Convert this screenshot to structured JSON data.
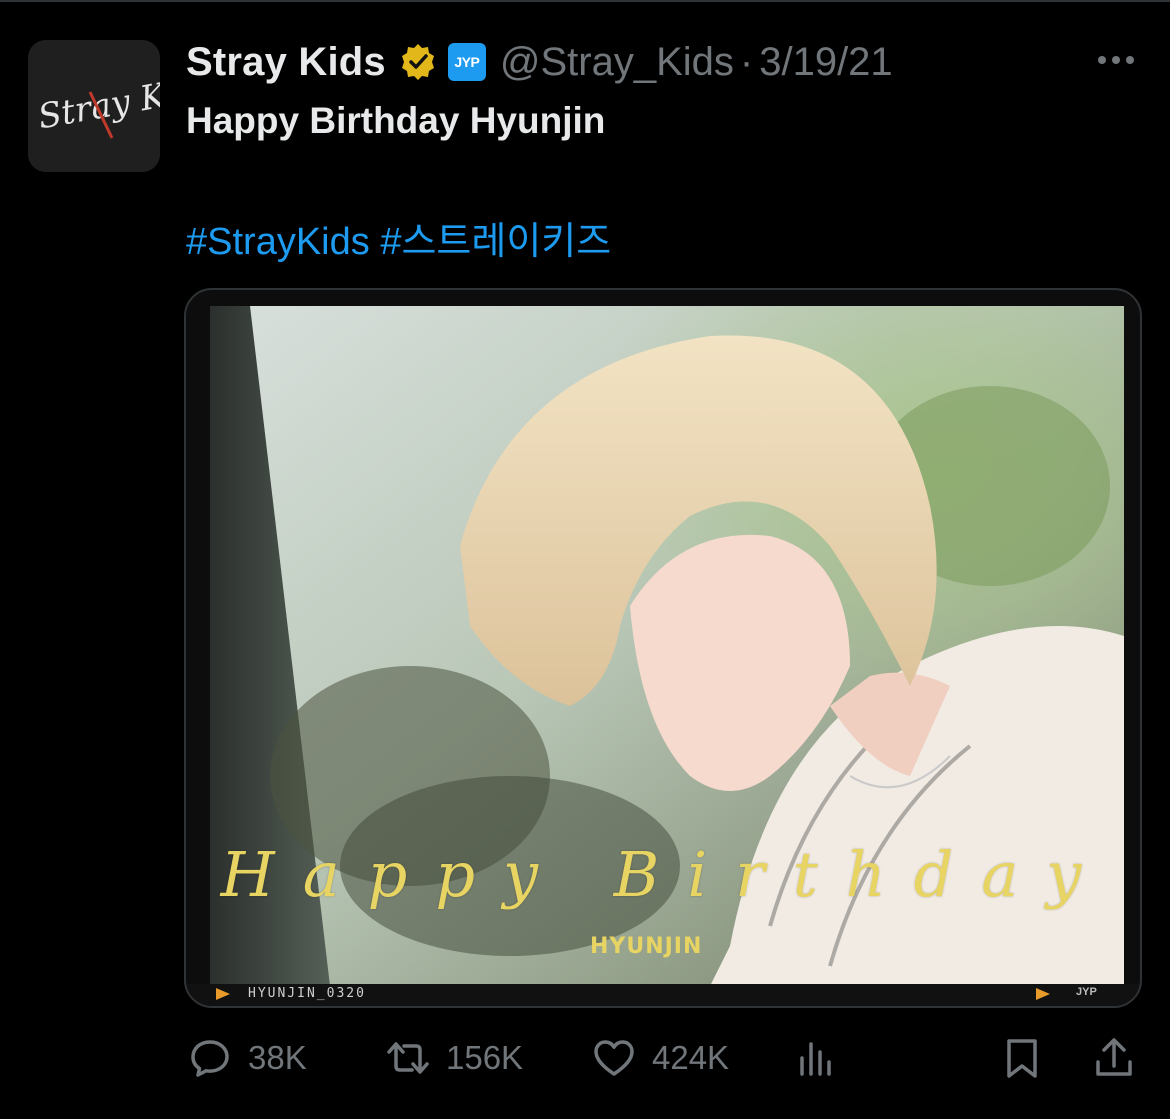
{
  "author": {
    "display_name": "Stray Kids",
    "handle": "@Stray_Kids",
    "separator": "·",
    "date": "3/19/21",
    "affiliate_badge": "JYP",
    "avatar_text": "Stray Kids"
  },
  "tweet": {
    "text": "Happy Birthday Hyunjin",
    "hashtags": [
      "#StrayKids",
      "#스트레이키즈"
    ]
  },
  "media": {
    "overlay_cursive": "Happy Birthday",
    "overlay_name": "HYUNJIN",
    "film_label": "HYUNJIN_0320",
    "corner_logo": "JYP"
  },
  "actions": {
    "replies": "38K",
    "retweets": "156K",
    "likes": "424K"
  },
  "colors": {
    "background": "#000000",
    "text": "#e7e9ea",
    "muted": "#71767b",
    "link": "#1d9bf0",
    "verified_gold": "#e2b719",
    "overlay_gold": "#e8d462"
  },
  "icons": [
    "verified-icon",
    "more-icon",
    "reply-icon",
    "retweet-icon",
    "like-icon",
    "views-icon",
    "bookmark-icon",
    "share-icon"
  ]
}
